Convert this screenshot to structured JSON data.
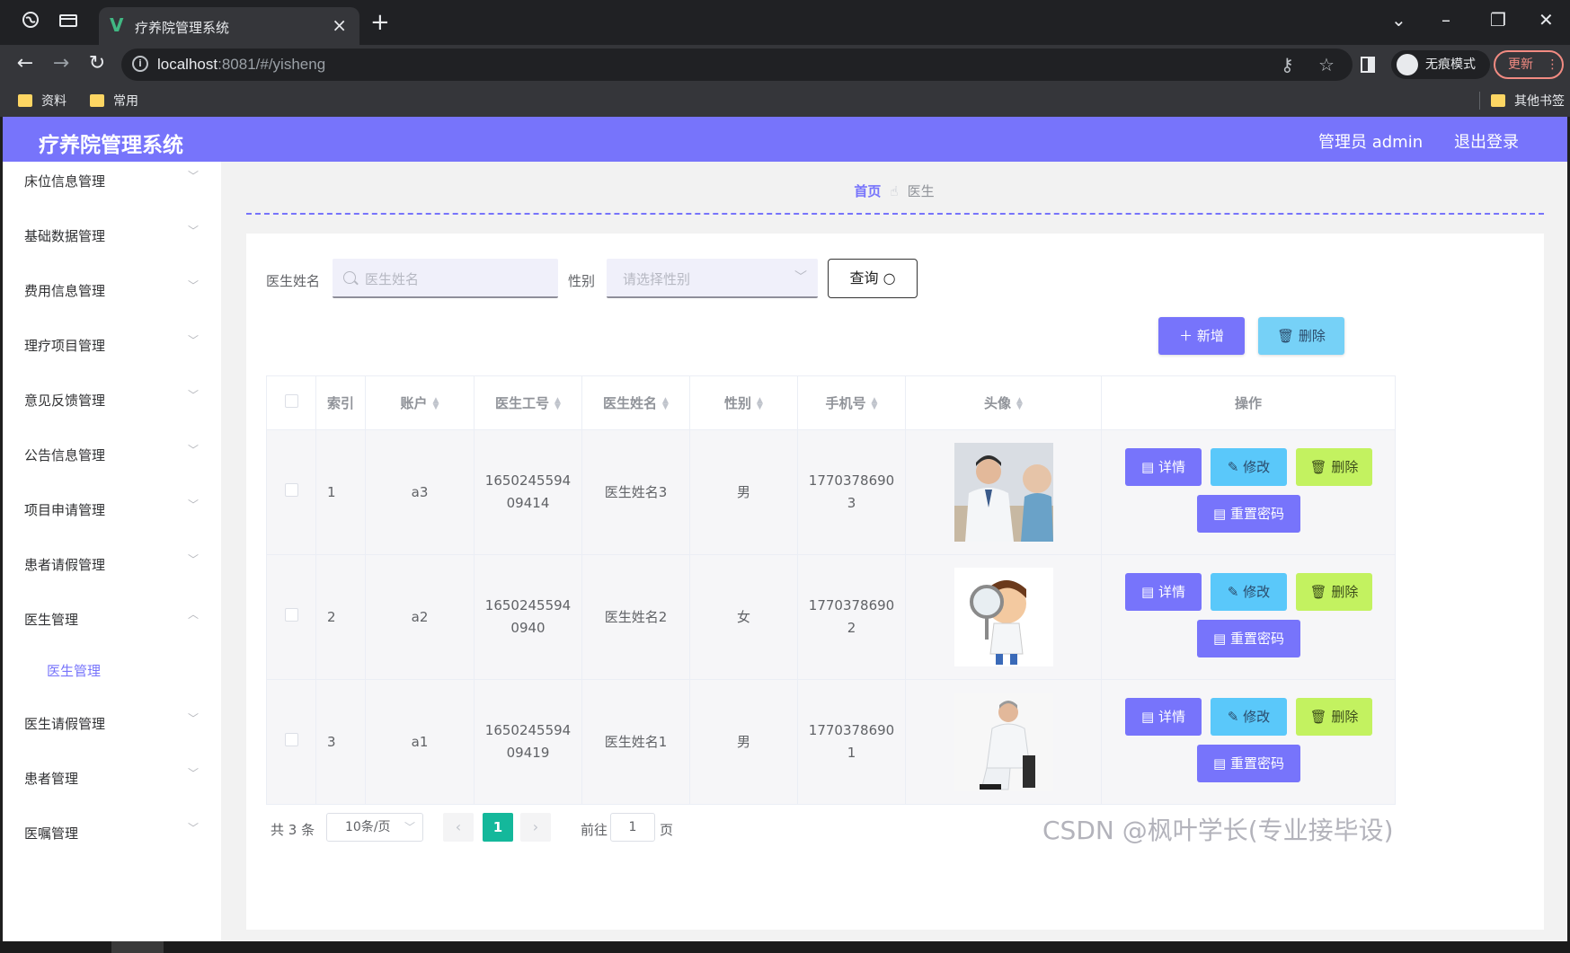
{
  "browser": {
    "tab_title": "疗养院管理系统",
    "tab_logo": "V",
    "url_host": "localhost",
    "url_path": ":8081/#/yisheng",
    "incognito_label": "无痕模式",
    "update_label": "更新",
    "bookmarks": [
      "资料",
      "常用"
    ],
    "other_bookmarks": "其他书签"
  },
  "header": {
    "title": "疗养院管理系统",
    "user": "管理员 admin",
    "logout": "退出登录"
  },
  "sidebar": {
    "items": [
      {
        "label": "床位信息管理"
      },
      {
        "label": "基础数据管理"
      },
      {
        "label": "费用信息管理"
      },
      {
        "label": "理疗项目管理"
      },
      {
        "label": "意见反馈管理"
      },
      {
        "label": "公告信息管理"
      },
      {
        "label": "项目申请管理"
      },
      {
        "label": "患者请假管理"
      },
      {
        "label": "医生管理"
      },
      {
        "label": "医生请假管理"
      },
      {
        "label": "患者管理"
      },
      {
        "label": "医嘱管理"
      }
    ],
    "active_sub": "医生管理"
  },
  "breadcrumb": {
    "home": "首页",
    "current": "医生"
  },
  "search": {
    "name_label": "医生姓名",
    "name_placeholder": "医生姓名",
    "gender_label": "性别",
    "gender_placeholder": "请选择性别",
    "query_button": "查询"
  },
  "actions": {
    "add": "＋ 新增",
    "delete": "删除"
  },
  "table": {
    "headers": [
      "索引",
      "账户",
      "医生工号",
      "医生姓名",
      "性别",
      "手机号",
      "头像",
      "操作"
    ],
    "rows": [
      {
        "index": "1",
        "account": "a3",
        "id_line1": "1650245594",
        "id_line2": "09414",
        "name": "医生姓名3",
        "gender": "男",
        "phone_line1": "1770378690",
        "phone_line2": "3"
      },
      {
        "index": "2",
        "account": "a2",
        "id_line1": "1650245594",
        "id_line2": "0940",
        "name": "医生姓名2",
        "gender": "女",
        "phone_line1": "1770378690",
        "phone_line2": "2"
      },
      {
        "index": "3",
        "account": "a1",
        "id_line1": "1650245594",
        "id_line2": "09419",
        "name": "医生姓名1",
        "gender": "男",
        "phone_line1": "1770378690",
        "phone_line2": "1"
      }
    ],
    "op_detail": "详情",
    "op_edit": "修改",
    "op_delete": "删除",
    "op_reset": "重置密码"
  },
  "pagination": {
    "total": "共 3 条",
    "page_size": "10条/页",
    "current_page": "1",
    "goto_label": "前往",
    "goto_value": "1",
    "page_suffix": "页"
  },
  "watermark": "CSDN @枫叶学长(专业接毕设)",
  "colors": {
    "primary": "#7774fb",
    "info": "#5ac8fa",
    "lime": "#c3f260",
    "page_active": "#14b89b"
  }
}
